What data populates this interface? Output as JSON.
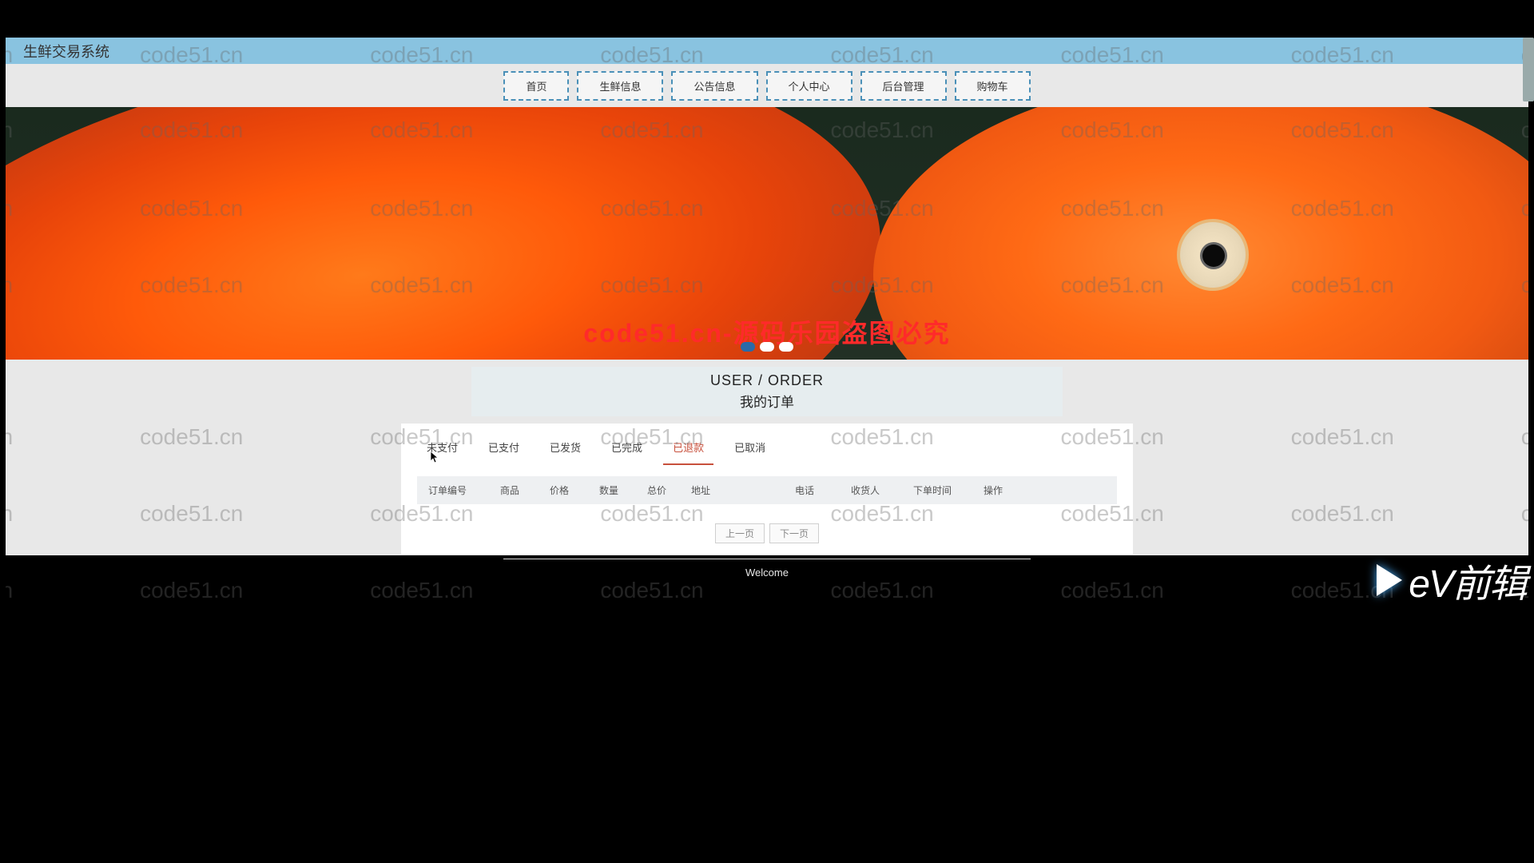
{
  "watermark": "code51.cn",
  "topbar": {
    "title": "生鲜交易系统"
  },
  "nav": {
    "items": [
      "首页",
      "生鲜信息",
      "公告信息",
      "个人中心",
      "后台管理",
      "购物车"
    ]
  },
  "hero": {
    "overlay_text": "code51.cn-源码乐园盗图必究"
  },
  "section": {
    "title_en": "USER / ORDER",
    "title_cn": "我的订单"
  },
  "tabs": {
    "items": [
      "未支付",
      "已支付",
      "已发货",
      "已完成",
      "已退款",
      "已取消"
    ],
    "active_index": 4
  },
  "table": {
    "columns": [
      "订单编号",
      "商品",
      "价格",
      "数量",
      "总价",
      "地址",
      "电话",
      "收货人",
      "下单时间",
      "操作"
    ]
  },
  "pager": {
    "prev": "上一页",
    "next": "下一页"
  },
  "footer": {
    "text": "Welcome"
  },
  "ev_badge": {
    "text": "eV前辑"
  }
}
